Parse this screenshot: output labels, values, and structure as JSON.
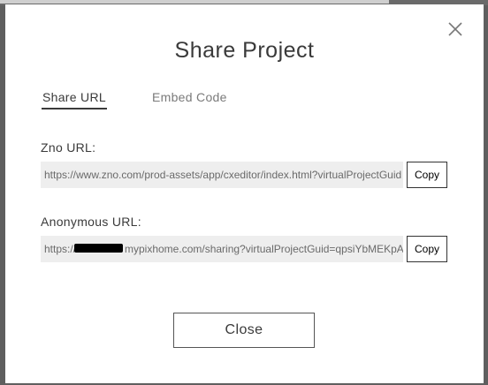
{
  "dialog": {
    "title": "Share Project",
    "tabs": [
      {
        "label": "Share URL",
        "active": true
      },
      {
        "label": "Embed Code",
        "active": false
      }
    ],
    "zno_url": {
      "label": "Zno URL:",
      "value": "https://www.zno.com/prod-assets/app/cxeditor/index.html?virtualProjectGuid",
      "copy_label": "Copy"
    },
    "anonymous_url": {
      "label": "Anonymous URL:",
      "prefix": "https://",
      "suffix": "mypixhome.com/sharing?virtualProjectGuid=qpsiYbMEKpA",
      "copy_label": "Copy"
    },
    "close_label": "Close"
  },
  "colors": {
    "backdrop": "#5f5f5f",
    "modal_bg": "#ffffff",
    "field_bg": "#eeeeee",
    "text_dark": "#3a3a3a",
    "text_muted": "#7a7a7a"
  },
  "icons": {
    "close": "close-icon"
  }
}
